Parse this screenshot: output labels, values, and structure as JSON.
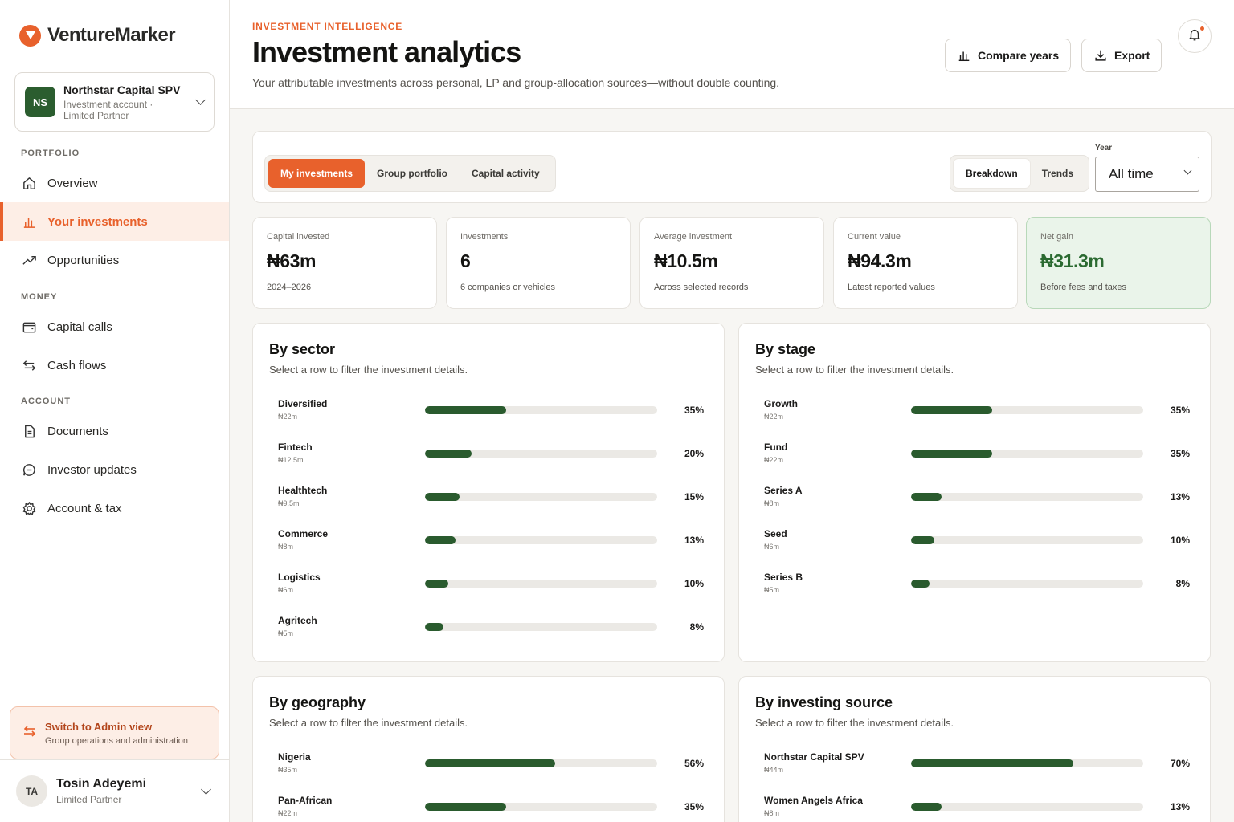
{
  "brand": {
    "name": "VentureMarker",
    "accent": "#e8612c",
    "positive": "#2a5b2e"
  },
  "account": {
    "initials": "NS",
    "name": "Northstar Capital SPV",
    "subtitle": "Investment account · Limited Partner"
  },
  "nav": {
    "sections": {
      "portfolio": "PORTFOLIO",
      "money": "MONEY",
      "account": "ACCOUNT"
    },
    "items": [
      {
        "label": "Overview",
        "icon": "home-icon",
        "active": false
      },
      {
        "label": "Your investments",
        "icon": "bar-chart-icon",
        "active": true
      },
      {
        "label": "Opportunities",
        "icon": "trending-up-icon",
        "active": false
      },
      {
        "label": "Capital calls",
        "icon": "wallet-icon",
        "active": false
      },
      {
        "label": "Cash flows",
        "icon": "arrows-swap-icon",
        "active": false
      },
      {
        "label": "Documents",
        "icon": "document-icon",
        "active": false
      },
      {
        "label": "Investor updates",
        "icon": "chat-icon",
        "active": false
      },
      {
        "label": "Account & tax",
        "icon": "gear-icon",
        "active": false
      }
    ]
  },
  "admin_switch": {
    "title": "Switch to Admin view",
    "subtitle": "Group operations and administration"
  },
  "user": {
    "initials": "TA",
    "name": "Tosin Adeyemi",
    "role": "Limited Partner"
  },
  "header": {
    "eyebrow": "INVESTMENT INTELLIGENCE",
    "title": "Investment analytics",
    "subtitle": "Your attributable investments across personal, LP and group-allocation sources—without double counting.",
    "compare_label": "Compare years",
    "export_label": "Export"
  },
  "toolbar": {
    "tabs": [
      {
        "label": "My investments",
        "active": true
      },
      {
        "label": "Group portfolio",
        "active": false
      },
      {
        "label": "Capital activity",
        "active": false
      }
    ],
    "views": [
      {
        "label": "Breakdown",
        "active": true
      },
      {
        "label": "Trends",
        "active": false
      }
    ],
    "year_label": "Year",
    "year_value": "All time"
  },
  "kpis": [
    {
      "label": "Capital invested",
      "value": "₦63m",
      "sub": "2024–2026"
    },
    {
      "label": "Investments",
      "value": "6",
      "sub": "6 companies or vehicles"
    },
    {
      "label": "Average investment",
      "value": "₦10.5m",
      "sub": "Across selected records"
    },
    {
      "label": "Current value",
      "value": "₦94.3m",
      "sub": "Latest reported values"
    },
    {
      "label": "Net gain",
      "value": "₦31.3m",
      "sub": "Before fees and taxes"
    }
  ],
  "breakdowns": {
    "sector": {
      "title": "By sector",
      "subtitle": "Select a row to filter the investment details.",
      "rows": [
        {
          "name": "Diversified",
          "amount": "₦22m",
          "pct": 35,
          "pct_label": "35%"
        },
        {
          "name": "Fintech",
          "amount": "₦12.5m",
          "pct": 20,
          "pct_label": "20%"
        },
        {
          "name": "Healthtech",
          "amount": "₦9.5m",
          "pct": 15,
          "pct_label": "15%"
        },
        {
          "name": "Commerce",
          "amount": "₦8m",
          "pct": 13,
          "pct_label": "13%"
        },
        {
          "name": "Logistics",
          "amount": "₦6m",
          "pct": 10,
          "pct_label": "10%"
        },
        {
          "name": "Agritech",
          "amount": "₦5m",
          "pct": 8,
          "pct_label": "8%"
        }
      ]
    },
    "stage": {
      "title": "By stage",
      "subtitle": "Select a row to filter the investment details.",
      "rows": [
        {
          "name": "Growth",
          "amount": "₦22m",
          "pct": 35,
          "pct_label": "35%"
        },
        {
          "name": "Fund",
          "amount": "₦22m",
          "pct": 35,
          "pct_label": "35%"
        },
        {
          "name": "Series A",
          "amount": "₦8m",
          "pct": 13,
          "pct_label": "13%"
        },
        {
          "name": "Seed",
          "amount": "₦6m",
          "pct": 10,
          "pct_label": "10%"
        },
        {
          "name": "Series B",
          "amount": "₦5m",
          "pct": 8,
          "pct_label": "8%"
        }
      ]
    },
    "geography": {
      "title": "By geography",
      "subtitle": "Select a row to filter the investment details.",
      "rows": [
        {
          "name": "Nigeria",
          "amount": "₦35m",
          "pct": 56,
          "pct_label": "56%"
        },
        {
          "name": "Pan-African",
          "amount": "₦22m",
          "pct": 35,
          "pct_label": "35%"
        }
      ]
    },
    "source": {
      "title": "By investing source",
      "subtitle": "Select a row to filter the investment details.",
      "rows": [
        {
          "name": "Northstar Capital SPV",
          "amount": "₦44m",
          "pct": 70,
          "pct_label": "70%"
        },
        {
          "name": "Women Angels Africa",
          "amount": "₦8m",
          "pct": 13,
          "pct_label": "13%"
        }
      ]
    }
  }
}
